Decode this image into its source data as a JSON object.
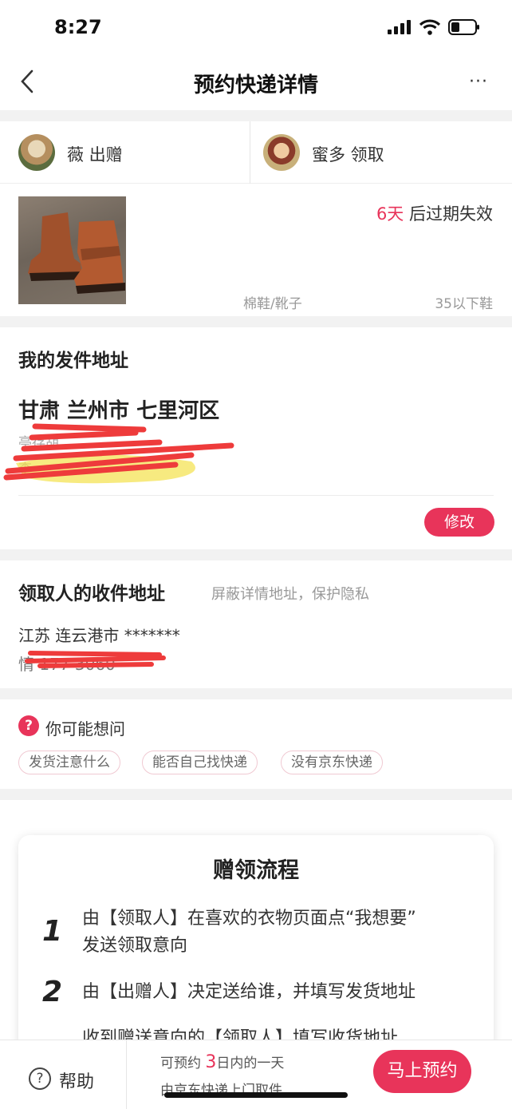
{
  "status": {
    "time": "8:27"
  },
  "nav": {
    "title": "预约快递详情",
    "more": "···"
  },
  "users": {
    "giver_name": "薇 出赠",
    "receiver_name": "蜜多 领取"
  },
  "item": {
    "expire_days": "6天",
    "expire_suffix": " 后过期失效",
    "category": "棉鞋/靴子",
    "size": "35以下鞋"
  },
  "sender": {
    "title": "我的发件地址",
    "region": "甘肃 兰州市 七里河区",
    "line1": "亭存胡",
    "line2": "李",
    "edit_label": "修改"
  },
  "receiver": {
    "title": "领取人的收件地址",
    "privacy_note": "屏蔽详情地址，保护隐私",
    "region": "江苏 连云港市 *******",
    "phone": "情 177 3060"
  },
  "faq": {
    "title": "你可能想问",
    "chips": [
      "发货注意什么",
      "能否自己找快递",
      "没有京东快递"
    ]
  },
  "process": {
    "title": "赠领流程",
    "steps": [
      {
        "num": "1",
        "text_line1": "由【领取人】在喜欢的衣物页面点“我想要”",
        "text_line2": "发送领取意向"
      },
      {
        "num": "2",
        "text_line1": "由【出赠人】决定送给谁，并填写发货地址",
        "text_line2": ""
      },
      {
        "num": "",
        "text_line1": "收到赠送意向的【领取人】填写收货地址",
        "text_line2": ""
      }
    ]
  },
  "bottom": {
    "help_label": "帮助",
    "tip_prefix": "可预约 ",
    "tip_days": "3",
    "tip_suffix": "日内的一天",
    "tip_line2": "由京东快递上门取件",
    "book_label": "马上预约"
  },
  "colors": {
    "accent": "#e8345a",
    "gap": "#f2f2f2"
  }
}
